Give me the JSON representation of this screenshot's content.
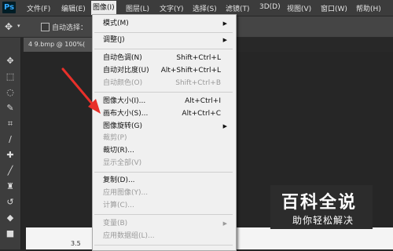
{
  "app": {
    "logo": "Ps"
  },
  "menubar": {
    "items": [
      "文件(F)",
      "编辑(E)",
      "图像(I)",
      "图层(L)",
      "文字(Y)",
      "选择(S)",
      "滤镜(T)",
      "3D(D)",
      "视图(V)",
      "窗口(W)",
      "帮助(H)"
    ],
    "active": "图像(I)"
  },
  "options_bar": {
    "auto_select_label": "自动选择："
  },
  "document_tab": {
    "title": "4 9.bmp @ 100%("
  },
  "image_menu": {
    "items": [
      {
        "label": "模式(M)",
        "shortcut": "",
        "submenu": true,
        "disabled": false
      },
      {
        "label": "调整(J)",
        "shortcut": "",
        "submenu": true,
        "disabled": false
      },
      {
        "label": "自动色调(N)",
        "shortcut": "Shift+Ctrl+L",
        "submenu": false,
        "disabled": false
      },
      {
        "label": "自动对比度(U)",
        "shortcut": "Alt+Shift+Ctrl+L",
        "submenu": false,
        "disabled": false
      },
      {
        "label": "自动颜色(O)",
        "shortcut": "Shift+Ctrl+B",
        "submenu": false,
        "disabled": true
      },
      {
        "label": "图像大小(I)...",
        "shortcut": "Alt+Ctrl+I",
        "submenu": false,
        "disabled": false
      },
      {
        "label": "画布大小(S)...",
        "shortcut": "Alt+Ctrl+C",
        "submenu": false,
        "disabled": false
      },
      {
        "label": "图像旋转(G)",
        "shortcut": "",
        "submenu": true,
        "disabled": false
      },
      {
        "label": "裁剪(P)",
        "shortcut": "",
        "submenu": false,
        "disabled": true
      },
      {
        "label": "裁切(R)...",
        "shortcut": "",
        "submenu": false,
        "disabled": false
      },
      {
        "label": "显示全部(V)",
        "shortcut": "",
        "submenu": false,
        "disabled": true
      },
      {
        "label": "复制(D)...",
        "shortcut": "",
        "submenu": false,
        "disabled": false
      },
      {
        "label": "应用图像(Y)...",
        "shortcut": "",
        "submenu": false,
        "disabled": true
      },
      {
        "label": "计算(C)...",
        "shortcut": "",
        "submenu": false,
        "disabled": true
      },
      {
        "label": "变量(B)",
        "shortcut": "",
        "submenu": true,
        "disabled": true
      },
      {
        "label": "应用数据组(L)...",
        "shortcut": "",
        "submenu": false,
        "disabled": true
      }
    ]
  },
  "watermark": {
    "title": "百科全说",
    "subtitle": "助你轻松解决"
  },
  "canvas_text": "3.5",
  "colors": {
    "arrow": "#e8302a",
    "menu_bg": "#f0f0f0",
    "menubar_bg": "#3c3c3c"
  }
}
